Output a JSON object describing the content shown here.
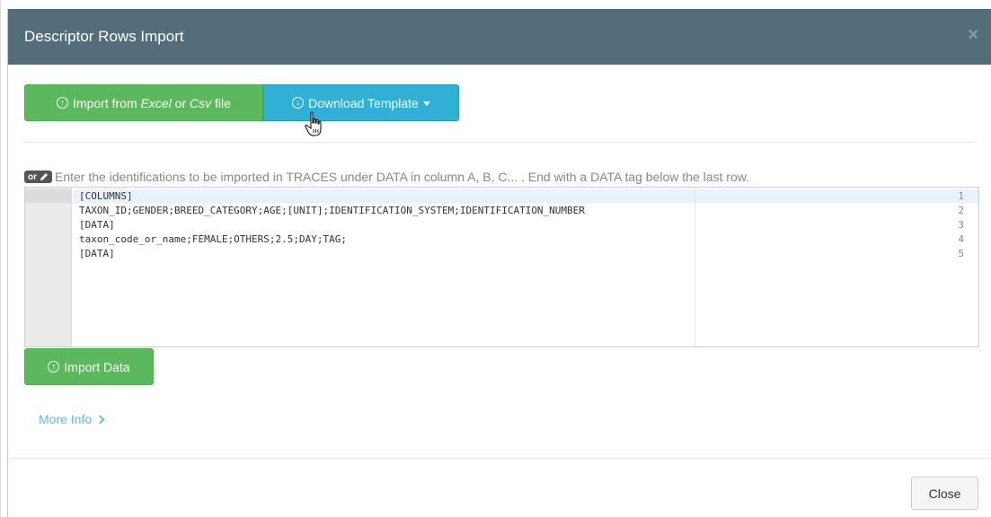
{
  "dialog": {
    "title": "Descriptor Rows Import",
    "close_icon": "×"
  },
  "toolbar": {
    "import_file": {
      "prefix": "Import from ",
      "excel": "Excel",
      "or": " or ",
      "csv": "Csv",
      "suffix": " file"
    },
    "download_template_label": "Download Template"
  },
  "hint": {
    "badge": "or",
    "text": "Enter the identifications to be imported in TRACES under DATA in column A, B, C... . End with a DATA tag below the last row."
  },
  "editor": {
    "line_numbers": [
      "1",
      "2",
      "3",
      "4",
      "5"
    ],
    "lines": [
      "[COLUMNS]",
      "TAXON_ID;GENDER;BREED_CATEGORY;AGE;[UNIT];IDENTIFICATION_SYSTEM;IDENTIFICATION_NUMBER",
      "[DATA]",
      "taxon_code_or_name;FEMALE;OTHERS;2.5;DAY;TAG;",
      "[DATA]"
    ],
    "active_line": 1
  },
  "import_data_label": "Import Data",
  "more_info_label": "More Info",
  "footer": {
    "close_label": "Close"
  },
  "colors": {
    "header_bg": "#546d7a",
    "success": "#5cb85c",
    "info": "#31b0d5",
    "link": "#5bc0de"
  },
  "icons": {
    "upload": "circle-arrow-up-icon",
    "download": "circle-arrow-down-icon",
    "pencil": "pencil-icon",
    "chevron": "chevron-right-icon",
    "cursor": "hand-pointer-cursor-icon"
  }
}
